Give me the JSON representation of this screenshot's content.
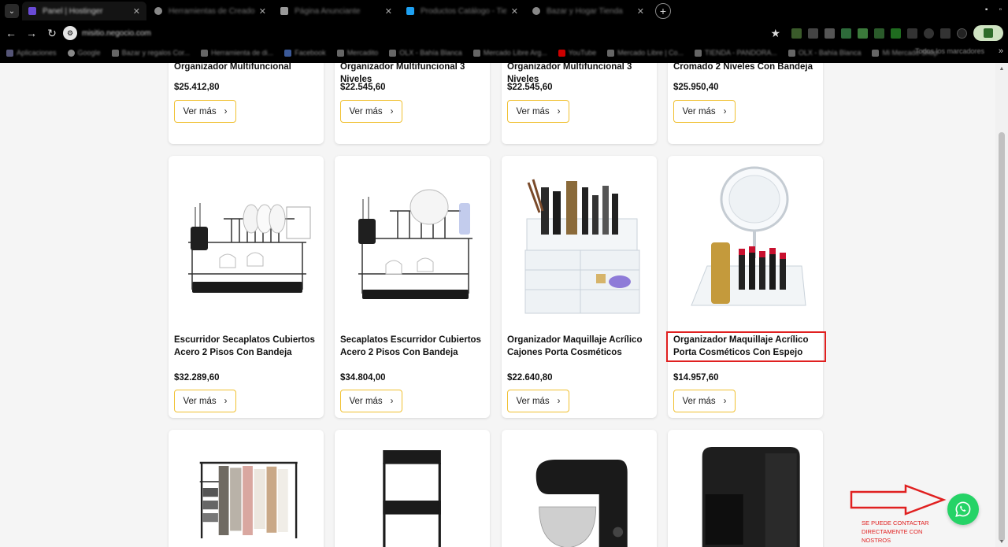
{
  "browser": {
    "tabs": [
      {
        "title": "Panel | Hostinger",
        "active": true
      },
      {
        "title": "Herramientas de Creador",
        "active": false
      },
      {
        "title": "Página Anunciante",
        "active": false
      },
      {
        "title": "Productos Catálogo - Tienda",
        "active": false
      },
      {
        "title": "Bazar y Hogar Tienda",
        "active": false
      }
    ],
    "new_tab": "+",
    "url": "misitio.negocio.com",
    "bookmarks": [
      "Aplicaciones",
      "Google",
      "Bazar y regalos Cor...",
      "Herramienta de di...",
      "Facebook",
      "Mercadito",
      "OLX - Bahía Blanca",
      "Mercado Libre Arg...",
      "YouTube",
      "Mercado Libre | Co...",
      "TIENDA - PANDORA...",
      "OLX - Bahía Blanca",
      "Mi Mercado Shop"
    ],
    "bookmarks_more": "Todos los marcadores"
  },
  "products": [
    {
      "title": "Organizador Multifuncional",
      "price": "$25.412,80",
      "button": "Ver más",
      "image": "organizer"
    },
    {
      "title": "Organizador Multifuncional 3 Niveles",
      "price": "$22.545,60",
      "button": "Ver más",
      "image": "organizer"
    },
    {
      "title": "Organizador Multifuncional 3 Niveles",
      "price": "$22.545,60",
      "button": "Ver más",
      "image": "organizer"
    },
    {
      "title": "Cromado 2 Niveles Con Bandeja",
      "price": "$25.950,40",
      "button": "Ver más",
      "image": "rack"
    },
    {
      "title": "Escurridor Secaplatos Cubiertos Acero 2 Pisos Con Bandeja",
      "price": "$32.289,60",
      "button": "Ver más",
      "image": "dish-rack"
    },
    {
      "title": "Secaplatos Escurridor Cubiertos Acero 2 Pisos Con Bandeja",
      "price": "$34.804,00",
      "button": "Ver más",
      "image": "dish-rack"
    },
    {
      "title": "Organizador Maquillaje Acrílico Cajones Porta Cosméticos",
      "price": "$22.640,80",
      "button": "Ver más",
      "image": "makeup-drawers"
    },
    {
      "title": "Organizador Maquillaje Acrílico Porta Cosméticos Con Espejo",
      "price": "$14.957,60",
      "button": "Ver más",
      "image": "makeup-mirror"
    },
    {
      "title": "",
      "price": "",
      "button": "",
      "image": "clothes-rack"
    },
    {
      "title": "",
      "price": "",
      "button": "",
      "image": "cart"
    },
    {
      "title": "",
      "price": "",
      "button": "",
      "image": "mixer"
    },
    {
      "title": "",
      "price": "",
      "button": "",
      "image": "coffee"
    }
  ],
  "annotation": {
    "note": "SE PUEDE CONTACTAR DIRECTAMENTE CON NOSTROS",
    "color": "#e02020"
  },
  "whatsapp": {
    "color": "#25d366"
  }
}
